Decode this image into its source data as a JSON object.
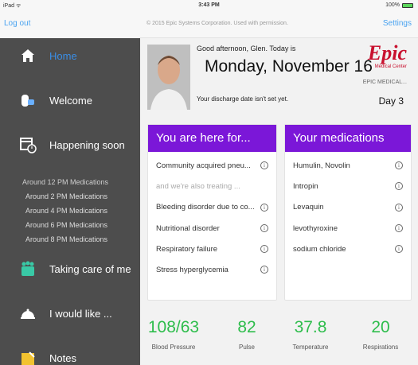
{
  "status_bar": {
    "device": "iPad ᯤ",
    "time": "3:43 PM",
    "battery": "100%"
  },
  "sidebar": {
    "logout_label": "Log out",
    "items": [
      {
        "label": "Home",
        "icon": "home-icon"
      },
      {
        "label": "Welcome",
        "icon": "welcome-icon"
      },
      {
        "label": "Happening soon",
        "icon": "calendar-clock-icon"
      },
      {
        "label": "Taking care of me",
        "icon": "care-team-icon"
      },
      {
        "label": "I would like ...",
        "icon": "service-bell-icon"
      },
      {
        "label": "Notes",
        "icon": "notes-icon"
      }
    ],
    "schedule": [
      "Around 12 PM Medications",
      "Around 2 PM Medications",
      "Around 4 PM Medications",
      "Around 6 PM Medications",
      "Around 8 PM Medications"
    ]
  },
  "header": {
    "copyright": "© 2015 Epic Systems Corporation. Used with permission.",
    "settings_label": "Settings"
  },
  "patient": {
    "greeting": "Good afternoon, Glen. Today is",
    "date": "Monday, November 16",
    "discharge": "Your discharge date isn't set yet.",
    "logo_text": "Epic",
    "logo_sub": "Medical Center",
    "hospital": "EPIC MEDICAL...",
    "day": "Day 3"
  },
  "here_for": {
    "title": "You are here for...",
    "items": [
      "Community acquired pneu...",
      "and we're also treating ...",
      "Bleeding disorder due to co...",
      "Nutritional disorder",
      "Respiratory failure",
      "Stress hyperglycemia"
    ]
  },
  "medications": {
    "title": "Your medications",
    "items": [
      "Humulin, Novolin",
      "Intropin",
      "Levaquin",
      "levothyroxine",
      "sodium chloride"
    ]
  },
  "vitals": [
    {
      "value": "108/63",
      "label": "Blood Pressure"
    },
    {
      "value": "82",
      "label": "Pulse"
    },
    {
      "value": "37.8",
      "label": "Temperature"
    },
    {
      "value": "20",
      "label": "Respirations"
    }
  ],
  "colors": {
    "accent_purple": "#7b17d8",
    "vital_green": "#2ebd4c",
    "link_blue": "#4aa3f0",
    "logo_red": "#c8102e"
  }
}
